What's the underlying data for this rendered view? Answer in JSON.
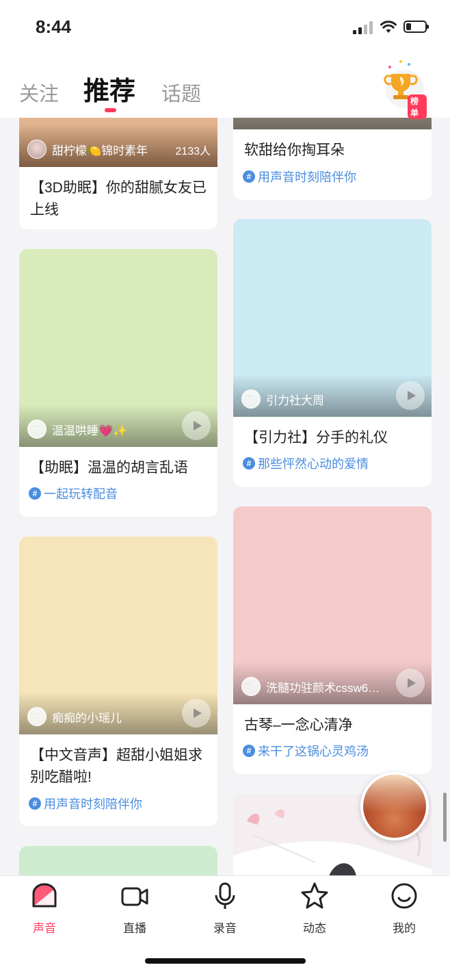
{
  "status_bar": {
    "time": "8:44"
  },
  "top_nav": {
    "tabs": [
      {
        "label": "关注",
        "active": false
      },
      {
        "label": "推荐",
        "active": true
      },
      {
        "label": "话题",
        "active": false
      }
    ],
    "rank_badge_label": "榜单",
    "accent_color": "#ff3b5c"
  },
  "feed": {
    "left": [
      {
        "author": "甜柠檬🍋锦时素年",
        "listeners": "2133人",
        "title": "【3D助眠】你的甜腻女友已上线",
        "topic": "",
        "cover_color": "#e8b896"
      },
      {
        "author": "温温哄睡💗✨",
        "title": "【助眠】温温的胡言乱语",
        "topic": "一起玩转配音",
        "cover_color": "#d9ebbb"
      },
      {
        "author": "痴痴的小瑶儿",
        "title": "【中文音声】超甜小姐姐求别吃醋啦!",
        "topic": "用声音时刻陪伴你",
        "cover_color": "#f6e5b8"
      },
      {
        "cover_color": "#cdeccf"
      }
    ],
    "right": [
      {
        "title": "软甜给你掏耳朵",
        "topic": "用声音时刻陪伴你",
        "cover_color": "#8e8a7c"
      },
      {
        "author": "引力社大周",
        "title": "【引力社】分手的礼仪",
        "topic": "那些怦然心动的爱情",
        "cover_color": "#cbeaf4"
      },
      {
        "author": "洗髓功驻颜术cssw6…",
        "title": "古琴–一念心清净",
        "topic": "来干了这锅心灵鸡汤",
        "cover_color": "#f4cacb"
      },
      {
        "cover_color": "#f4eef0"
      }
    ]
  },
  "tab_bar": [
    {
      "label": "声音",
      "icon": "sound-icon",
      "active": true
    },
    {
      "label": "直播",
      "icon": "live-camera-icon",
      "active": false
    },
    {
      "label": "录音",
      "icon": "microphone-icon",
      "active": false
    },
    {
      "label": "动态",
      "icon": "star-icon",
      "active": false
    },
    {
      "label": "我的",
      "icon": "profile-icon",
      "active": false
    }
  ]
}
